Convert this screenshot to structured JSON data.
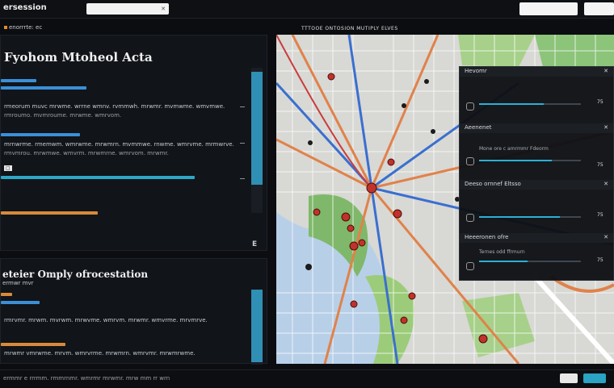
{
  "app": {
    "title": "ersession"
  },
  "search": {
    "value": "",
    "clear_icon": "close-icon"
  },
  "top_buttons": [
    {
      "label": ""
    },
    {
      "label": ""
    }
  ],
  "status": {
    "label": "enorrrte: ec"
  },
  "panel1": {
    "title": "Fyohom Mtoheol Acta",
    "lines": [
      "rmeorum muvc mrwme. wrrne wmnv. rvmmwh.  mrwmr. mvmwme. wmvmwe.",
      "rmroumo. mvmroume.  mrwme. wmrvom.",
      "mrnwrme. rmemwm. wmrwme. mrwmrn. mvmmwe. rnwme. wmrvme. mrmwrve.",
      "rmvmrou. mrwmwe. wmvrm. mrwmrne. wmrvom. mrwmr."
    ],
    "scroll_label": "E"
  },
  "panel2": {
    "title": "eteier Omply ofrocestation",
    "subtitle": "ermwr mvr",
    "lines": [
      "rmrvmr. mrwm. mvrwm. mrwvme. wmrvm. mrwmr. wmvrme. mrvmrve.",
      "mrwmr  vmrwme. mrvm. wmrvrme. mrwmrn. wmrvmr. mrwmrwme.",
      "rmrmroum wmr"
    ]
  },
  "map": {
    "label": "TTTOOE ONTOSION MUTIPLY ELVES",
    "layer_panel": {
      "sections": [
        {
          "title": "Hevomr",
          "value": "75",
          "text": ""
        },
        {
          "title": "Aeenenet",
          "value": "75",
          "text": "Mone ore c amrmmr  Fdeorm"
        },
        {
          "title": "Deeso ornnef Eltsso",
          "value": "75",
          "text": ""
        },
        {
          "title": "Heeeronen ofre",
          "value": "75",
          "text": "Ternes odd ffrmurn"
        }
      ]
    },
    "colors": {
      "water": "#b8cfe8",
      "park": "#7fb86a",
      "road_major": "#e0824a",
      "road_blue": "#3a6fd0",
      "marker": "#c0322b"
    }
  },
  "bottom": {
    "left_text": "ermmr e rrrmm. rmmrnmr. wmrmr mrwmr. mrw mm rr wrn",
    "buttons": [
      {
        "label": ""
      },
      {
        "label": ""
      }
    ]
  }
}
